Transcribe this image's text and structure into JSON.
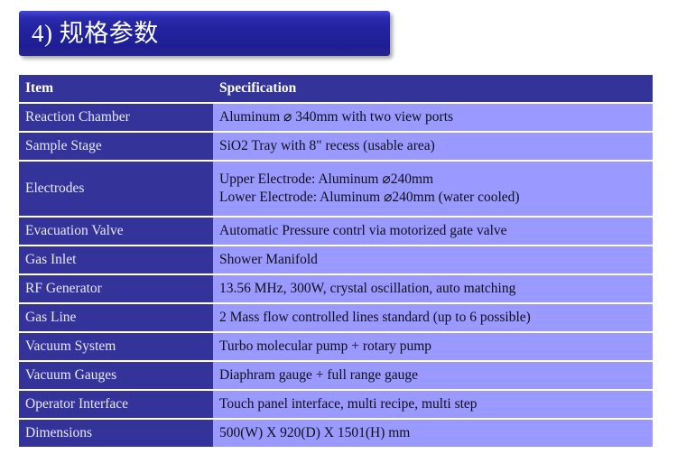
{
  "slide": {
    "title": "4) 规格参数",
    "colors": {
      "banner_top": "#4a4ad8",
      "banner_bottom": "#1e1e93",
      "header_bg": "#333399",
      "item_cell_bg": "#333399",
      "spec_cell_bg": "#9999ff",
      "item_text": "#e8e8ff",
      "spec_text": "#10101a",
      "page_bg": "#ffffff"
    }
  },
  "table": {
    "headers": {
      "item": "Item",
      "specification": "Specification"
    },
    "rows": [
      {
        "item": "Reaction Chamber",
        "spec_lines": [
          "Aluminum ⌀ 340mm with two view ports"
        ]
      },
      {
        "item": "Sample Stage",
        "spec_lines": [
          "SiO2 Tray with 8\" recess (usable area)"
        ]
      },
      {
        "item": "Electrodes",
        "spec_lines": [
          "Upper Electrode: Aluminum ⌀240mm",
          "Lower Electrode: Aluminum ⌀240mm (water cooled)"
        ]
      },
      {
        "item": "Evacuation Valve",
        "spec_lines": [
          "Automatic Pressure contrl via motorized gate valve"
        ]
      },
      {
        "item": "Gas Inlet",
        "spec_lines": [
          "Shower Manifold"
        ]
      },
      {
        "item": "RF Generator",
        "spec_lines": [
          "13.56 MHz, 300W, crystal oscillation, auto matching"
        ]
      },
      {
        "item": "Gas Line",
        "spec_lines": [
          "2 Mass flow controlled lines standard (up to 6 possible)"
        ]
      },
      {
        "item": "Vacuum System",
        "spec_lines": [
          "Turbo molecular pump + rotary pump"
        ]
      },
      {
        "item": "Vacuum Gauges",
        "spec_lines": [
          "Diaphram gauge + full range gauge"
        ]
      },
      {
        "item": "Operator Interface",
        "spec_lines": [
          "Touch panel interface, multi recipe, multi step"
        ]
      },
      {
        "item": "Dimensions",
        "spec_lines": [
          "500(W) X 920(D) X 1501(H) mm"
        ]
      }
    ]
  }
}
